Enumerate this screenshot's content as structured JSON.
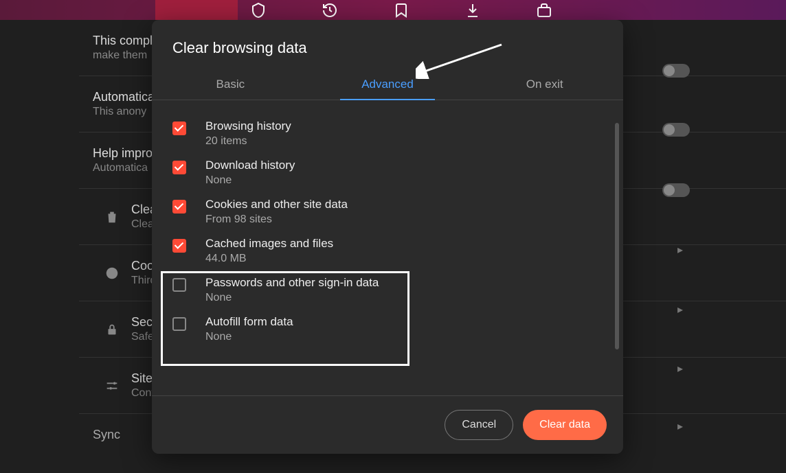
{
  "modal": {
    "title": "Clear browsing data",
    "tabs": {
      "basic": "Basic",
      "advanced": "Advanced",
      "onexit": "On exit"
    },
    "options": [
      {
        "label": "Browsing history",
        "sub": "20 items",
        "checked": true
      },
      {
        "label": "Download history",
        "sub": "None",
        "checked": true
      },
      {
        "label": "Cookies and other site data",
        "sub": "From 98 sites",
        "checked": true
      },
      {
        "label": "Cached images and files",
        "sub": "44.0 MB",
        "checked": true
      },
      {
        "label": "Passwords and other sign-in data",
        "sub": "None",
        "checked": false
      },
      {
        "label": "Autofill form data",
        "sub": "None",
        "checked": false
      }
    ],
    "cancel": "Cancel",
    "clear": "Clear data"
  },
  "bg": {
    "row0_title": "This compl",
    "row0_sub": "make them",
    "row1_title": "Automatica",
    "row1_sub": "This anony",
    "row2_title": "Help impro",
    "row2_sub": "Automatica",
    "row3_title": "Clea",
    "row3_sub": "Clea",
    "row4_title": "Cook",
    "row4_sub": "Third",
    "row5_title": "Secu",
    "row5_sub": "Safe",
    "row6_title": "Site",
    "row6_sub": "Cont",
    "sync": "Sync"
  }
}
